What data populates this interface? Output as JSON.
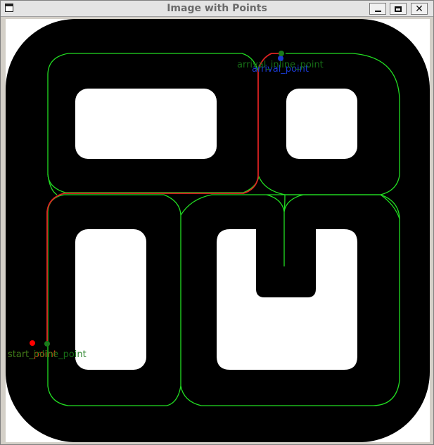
{
  "window": {
    "title": "Image with Points",
    "buttons": {
      "minimize": "_",
      "maximize": "□",
      "close": "✕"
    }
  },
  "colors": {
    "track": "#000000",
    "background": "#ffffff",
    "graph_edges": "#22dd22",
    "path": "#dd2222",
    "start_point": "#ff0000",
    "start_inline_point": "#1a7a1a",
    "arrival_point": "#1a3ad0",
    "arrival_inline_point": "#1a7a1a"
  },
  "labels": {
    "start_point": "start_point",
    "start_inline_point": "start_inline_point",
    "arrival_point": "arrival_point",
    "arrival_inline_point": "arrival_inline_point"
  },
  "icons": [
    "window-app-icon",
    "minimize-icon",
    "maximize-icon",
    "close-icon"
  ]
}
